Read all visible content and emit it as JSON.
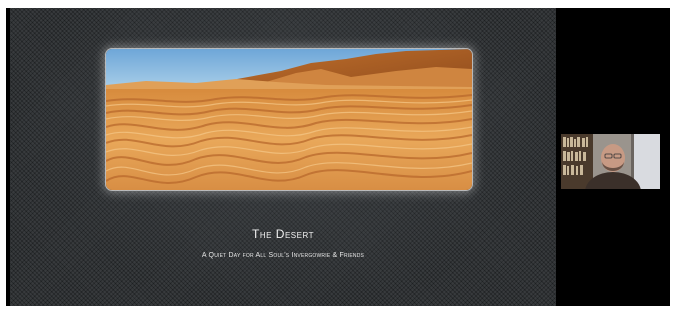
{
  "slide": {
    "title": "The Desert",
    "subtitle": "A Quiet Day for All Soul's Invergowrie & Friends"
  },
  "colors": {
    "background": "#000000",
    "slide_bg": "#2b2e31",
    "sky": "#7fb3de",
    "sand_light": "#e8a95a",
    "sand_dark": "#b8692b",
    "text": "#f2f2f2"
  },
  "icons": {
    "desert_photo": "desert-photo",
    "participant_video": "participant-video"
  }
}
